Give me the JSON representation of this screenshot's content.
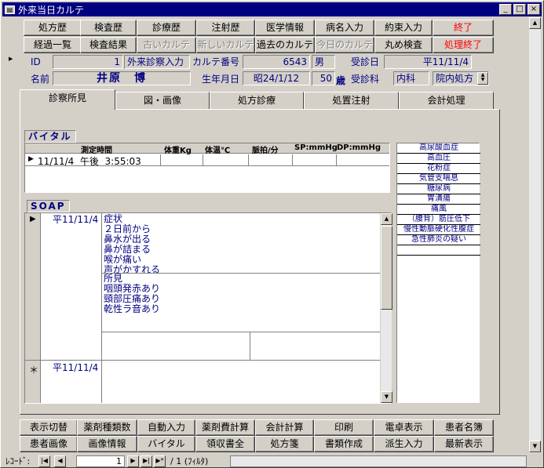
{
  "window": {
    "title": "外来当日カルテ",
    "min": "_",
    "max": "□",
    "close": "×"
  },
  "toolbar1": [
    "処方歴",
    "検査歴",
    "診療歴",
    "注射歴",
    "医学情報",
    "病名入力",
    "約束入力",
    "終了"
  ],
  "toolbar2": [
    "経過一覧",
    "検査結果",
    "古いカルテ",
    "新しいカルテ",
    "過去のカルテ",
    "今日のカルテ",
    "丸め検査",
    "処理終了"
  ],
  "patient": {
    "id_label": "ID",
    "id": "1",
    "entry_type": "外来診察入力",
    "chart_no_label": "カルテ番号",
    "chart_no": "6543",
    "sex": "男",
    "visit_date_label": "受診日",
    "visit_date": "平11/11/4",
    "name_label": "名前",
    "name": "井原　博",
    "dob_label": "生年月日",
    "dob": "昭24/1/12",
    "age": "50",
    "age_unit": "歳",
    "dept_label": "受診科",
    "dept": "内科",
    "rx_type": "院内処方"
  },
  "tabs": [
    "診察所見",
    "図・画像",
    "処方診療",
    "処置注射",
    "会計処理"
  ],
  "vital": {
    "section": "バイタル",
    "headers": [
      "測定時間",
      "体重Kg",
      "体温℃",
      "脈拍/分",
      "SP:mmHg",
      "DP:mmHg"
    ],
    "row_time": "11/11/4  午後  3:55:03"
  },
  "diagnoses": [
    "高尿酸血症",
    "高血圧",
    "花粉症",
    "気管支喘息",
    "糖尿病",
    "胃潰瘍",
    "痛風",
    "（腰背）筋圧低下",
    "慢性動脈硬化性腹症",
    "急性肺炎の疑い"
  ],
  "soap": {
    "section": "SOAP",
    "rec1_date": "平11/11/4",
    "subjective": [
      "症状",
      "２日前から",
      "鼻水が出る",
      "鼻が詰まる",
      "喉が痛い",
      "声がかすれる"
    ],
    "objective": [
      "所見",
      "咽頭発赤あり",
      "頸部圧痛あり",
      "乾性ラ音あり"
    ],
    "rec2_date": "平11/11/4",
    "row_marker": "▶",
    "new_marker": "＊"
  },
  "bottom1": [
    "表示切替",
    "薬剤種類数",
    "自動入力",
    "薬剤費計算",
    "会計計算",
    "印刷",
    "電卓表示",
    "患者名簿"
  ],
  "bottom2": [
    "患者画像",
    "画像情報",
    "バイタル",
    "領収書全",
    "処方箋",
    "書類作成",
    "派生入力",
    "最新表示"
  ],
  "record": {
    "label": "ﾚｺｰﾄﾞ:",
    "current": "1",
    "total": "/ 1 (ﾌｨﾙﾀ)"
  }
}
